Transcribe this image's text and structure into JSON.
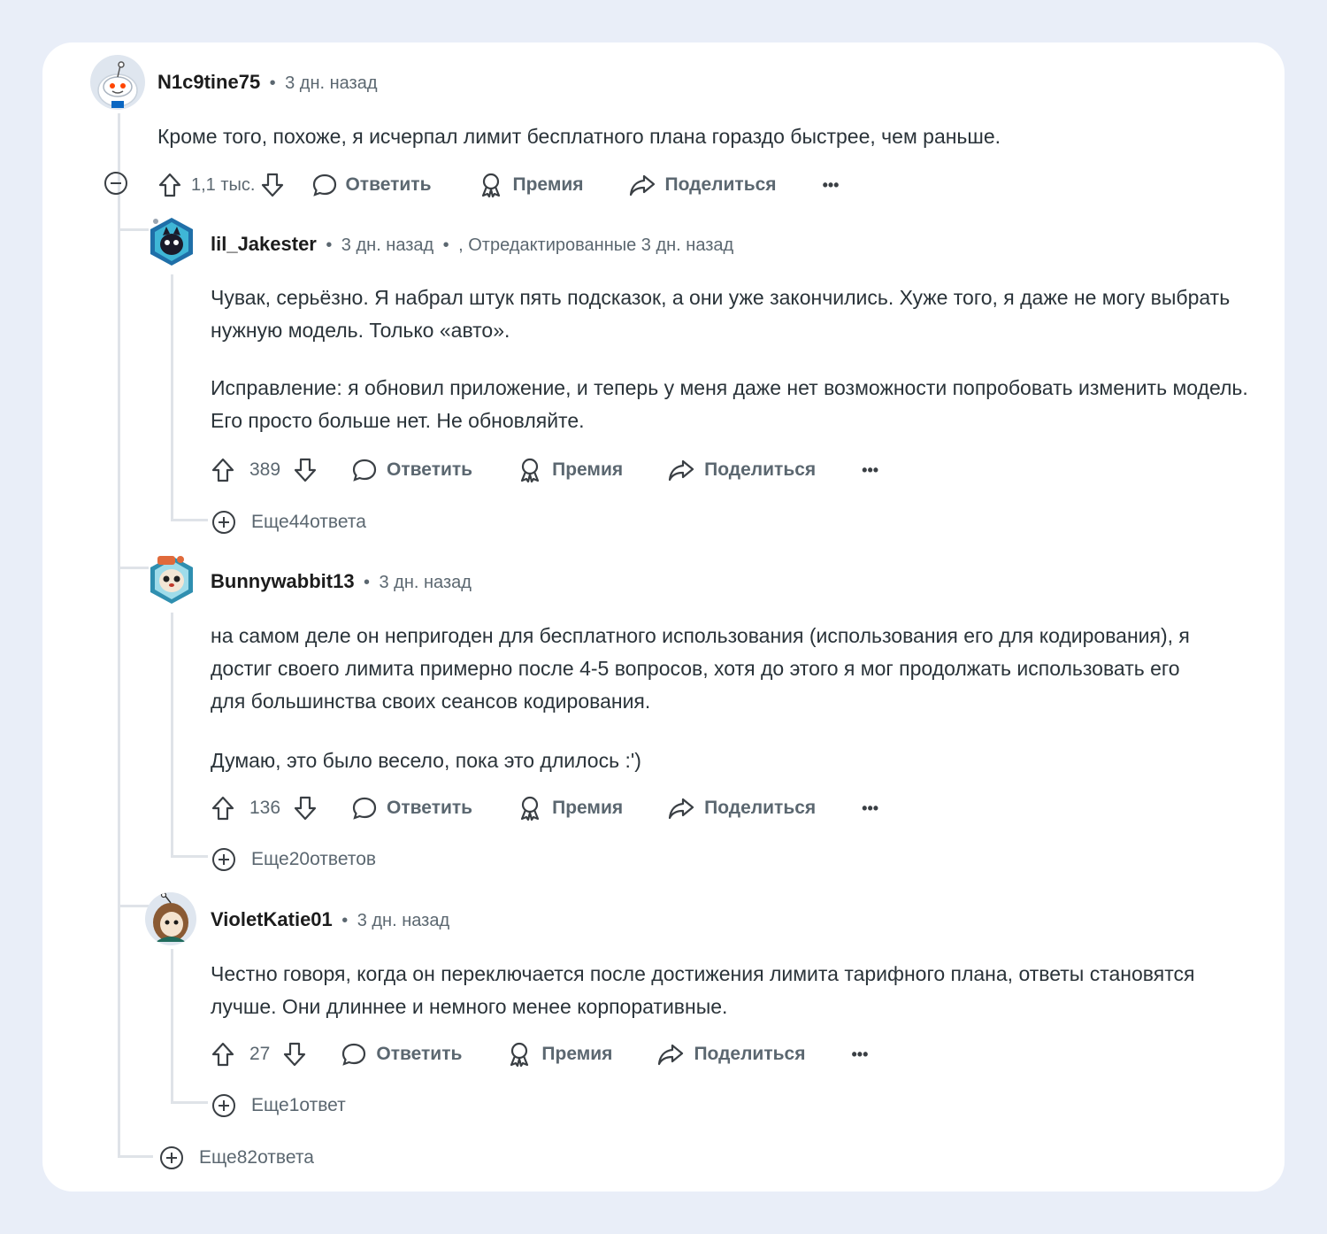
{
  "comments": [
    {
      "username": "N1c9tine75",
      "time": "3 дн. назад",
      "text": [
        "Кроме того, похоже, я исчерпал лимит бесплатного плана гораздо быстрее, чем раньше."
      ],
      "score": "1,1 тыс.",
      "reply": "Ответить",
      "award": "Премия",
      "share": "Поделиться",
      "more_icon": "•••"
    },
    {
      "username": "lil_Jakester",
      "time": "3 дн. назад",
      "edited": ", Отредактированные 3 дн. назад",
      "text": [
        "Чувак, серьёзно. Я набрал штук пять подсказок, а они уже закончились. Хуже того, я даже не могу выбрать нужную модель. Только «авто».",
        "Исправление: я обновил приложение, и теперь у меня даже нет возможности попробовать изменить модель. Его просто больше нет. Не обновляйте."
      ],
      "score": "389",
      "reply": "Ответить",
      "award": "Премия",
      "share": "Поделиться",
      "more_icon": "•••",
      "more_replies": "Еще44ответа"
    },
    {
      "username": "Bunnywabbit13",
      "time": "3 дн. назад",
      "text": [
        "на самом деле он непригоден для бесплатного использования (использования его для кодирования), я достиг своего лимита примерно после 4-5 вопросов, хотя до этого я мог продолжать использовать его для большинства своих сеансов кодирования.",
        "Думаю, это было весело, пока это длилось :')"
      ],
      "score": "136",
      "reply": "Ответить",
      "award": "Премия",
      "share": "Поделиться",
      "more_icon": "•••",
      "more_replies": "Еще20ответов"
    },
    {
      "username": "VioletKatie01",
      "time": "3 дн. назад",
      "text": [
        "Честно говоря, когда он переключается после достижения лимита тарифного плана, ответы становятся лучше. Они длиннее и немного менее корпоративные."
      ],
      "score": "27",
      "reply": "Ответить",
      "award": "Премия",
      "share": "Поделиться",
      "more_icon": "•••",
      "more_replies": "Еще1ответ"
    }
  ],
  "root_more_replies": "Еще82ответа",
  "colors": {
    "page_bg": "#e9eef8",
    "card_bg": "#ffffff",
    "meta": "#5b6770",
    "thread_line": "#dfe3e8"
  }
}
